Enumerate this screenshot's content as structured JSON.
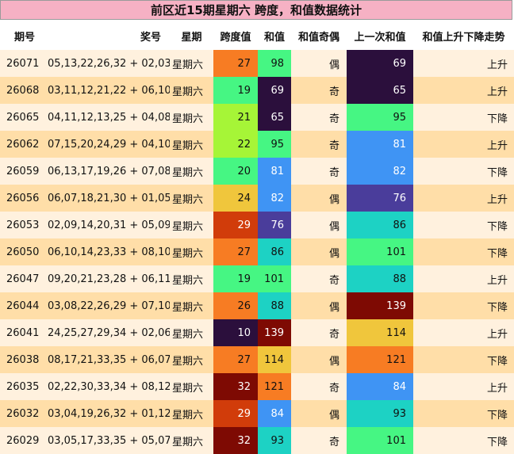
{
  "title": "前区近15期星期六 跨度，和值数据统计",
  "headers": {
    "issue": "期号",
    "numbers": "奖号",
    "weekday": "星期",
    "span": "跨度值",
    "sum": "和值",
    "parity": "和值奇偶",
    "prev_sum": "上一次和值",
    "trend": "和值上升下降走势"
  },
  "colors": {
    "title_bg": "#f6b1c4",
    "row_odd_bg": "#fff1de",
    "row_even_bg": "#ffdea8",
    "heat_scale": [
      "#2b0f3c",
      "#4a3d9b",
      "#3f94f4",
      "#1dd2c4",
      "#46f683",
      "#a6f537",
      "#f0c63c",
      "#f77c23",
      "#d13c0a",
      "#7e0a03"
    ]
  },
  "rows": [
    {
      "issue": "26071",
      "numbers": "05,13,22,26,32 + 02,03",
      "weekday": "星期六",
      "span": "27",
      "sum": "98",
      "parity": "偶",
      "prev_sum": "69",
      "trend": "上升"
    },
    {
      "issue": "26068",
      "numbers": "03,11,12,21,22 + 06,10",
      "weekday": "星期六",
      "span": "19",
      "sum": "69",
      "parity": "奇",
      "prev_sum": "65",
      "trend": "上升"
    },
    {
      "issue": "26065",
      "numbers": "04,11,12,13,25 + 04,08",
      "weekday": "星期六",
      "span": "21",
      "sum": "65",
      "parity": "奇",
      "prev_sum": "95",
      "trend": "下降"
    },
    {
      "issue": "26062",
      "numbers": "07,15,20,24,29 + 04,10",
      "weekday": "星期六",
      "span": "22",
      "sum": "95",
      "parity": "奇",
      "prev_sum": "81",
      "trend": "上升"
    },
    {
      "issue": "26059",
      "numbers": "06,13,17,19,26 + 07,08",
      "weekday": "星期六",
      "span": "20",
      "sum": "81",
      "parity": "奇",
      "prev_sum": "82",
      "trend": "下降"
    },
    {
      "issue": "26056",
      "numbers": "06,07,18,21,30 + 01,05",
      "weekday": "星期六",
      "span": "24",
      "sum": "82",
      "parity": "偶",
      "prev_sum": "76",
      "trend": "上升"
    },
    {
      "issue": "26053",
      "numbers": "02,09,14,20,31 + 05,09",
      "weekday": "星期六",
      "span": "29",
      "sum": "76",
      "parity": "偶",
      "prev_sum": "86",
      "trend": "下降"
    },
    {
      "issue": "26050",
      "numbers": "06,10,14,23,33 + 08,10",
      "weekday": "星期六",
      "span": "27",
      "sum": "86",
      "parity": "偶",
      "prev_sum": "101",
      "trend": "下降"
    },
    {
      "issue": "26047",
      "numbers": "09,20,21,23,28 + 06,11",
      "weekday": "星期六",
      "span": "19",
      "sum": "101",
      "parity": "奇",
      "prev_sum": "88",
      "trend": "上升"
    },
    {
      "issue": "26044",
      "numbers": "03,08,22,26,29 + 07,10",
      "weekday": "星期六",
      "span": "26",
      "sum": "88",
      "parity": "偶",
      "prev_sum": "139",
      "trend": "下降"
    },
    {
      "issue": "26041",
      "numbers": "24,25,27,29,34 + 02,06",
      "weekday": "星期六",
      "span": "10",
      "sum": "139",
      "parity": "奇",
      "prev_sum": "114",
      "trend": "上升"
    },
    {
      "issue": "26038",
      "numbers": "08,17,21,33,35 + 06,07",
      "weekday": "星期六",
      "span": "27",
      "sum": "114",
      "parity": "偶",
      "prev_sum": "121",
      "trend": "下降"
    },
    {
      "issue": "26035",
      "numbers": "02,22,30,33,34 + 08,12",
      "weekday": "星期六",
      "span": "32",
      "sum": "121",
      "parity": "奇",
      "prev_sum": "84",
      "trend": "上升"
    },
    {
      "issue": "26032",
      "numbers": "03,04,19,26,32 + 01,12",
      "weekday": "星期六",
      "span": "29",
      "sum": "84",
      "parity": "偶",
      "prev_sum": "93",
      "trend": "下降"
    },
    {
      "issue": "26029",
      "numbers": "03,05,17,33,35 + 05,07",
      "weekday": "星期六",
      "span": "32",
      "sum": "93",
      "parity": "奇",
      "prev_sum": "101",
      "trend": "下降"
    }
  ]
}
